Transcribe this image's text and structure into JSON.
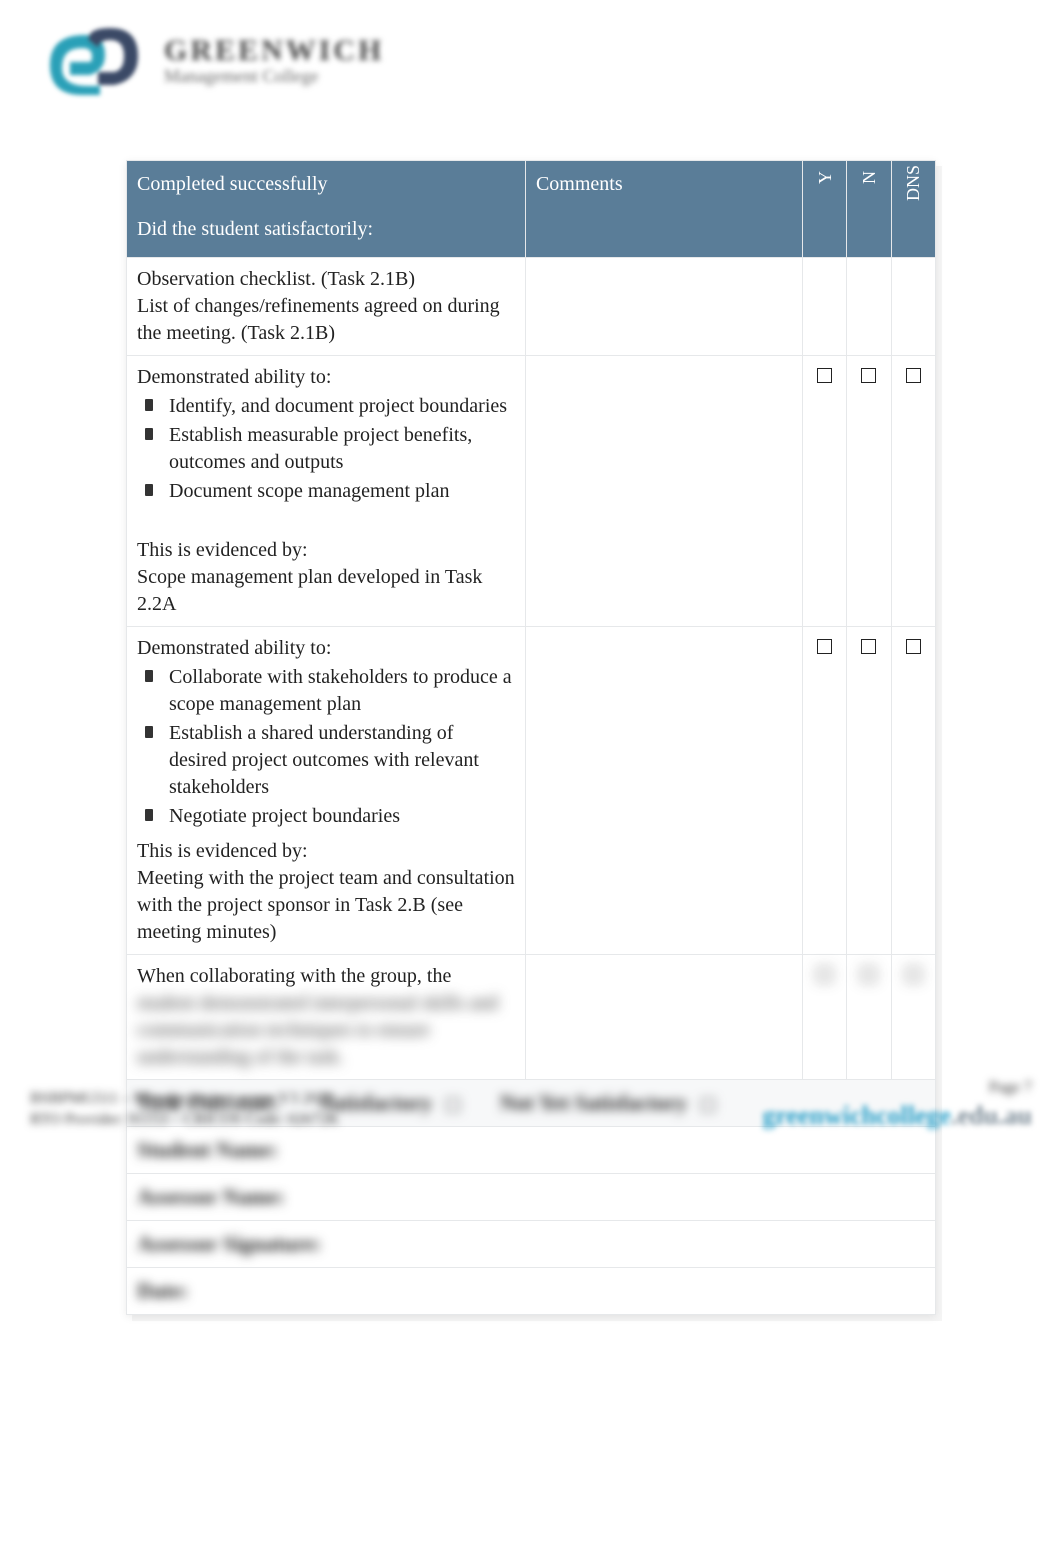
{
  "logo": {
    "line1": "GREENWICH",
    "line2": "Management College"
  },
  "header": {
    "col1_line1": "Completed successfully",
    "col1_line2": "Did the student satisfactorily:",
    "col2": "Comments",
    "col3": "Y",
    "col4": "N",
    "col5": "DNS"
  },
  "rows": [
    {
      "type": "plain",
      "lines": [
        "Observation checklist. (Task 2.1B)",
        "List of changes/refinements agreed on during the meeting. (Task 2.1B)"
      ],
      "checks": false
    },
    {
      "type": "ability",
      "intro": "Demonstrated ability to:",
      "bullets": [
        "Identify, and document project boundaries",
        "Establish measurable project benefits, outcomes and outputs",
        "Document scope management plan"
      ],
      "evidence_label": "This is evidenced by:",
      "evidence": "Scope management plan developed in Task 2.2A",
      "checks": true
    },
    {
      "type": "ability",
      "intro": "Demonstrated ability to:",
      "bullets": [
        "Collaborate with stakeholders to produce a scope management plan",
        "Establish a shared understanding of desired project outcomes with relevant stakeholders",
        "Negotiate project boundaries"
      ],
      "evidence_label": "This is evidenced by:",
      "evidence": "Meeting with the project team and consultation with the project sponsor in Task 2.B (see meeting minutes)",
      "checks": true
    },
    {
      "type": "collab",
      "line": "When collaborating with the group, the",
      "blur": "student demonstrated interpersonal skills and communication techniques to ensure understanding of the task.",
      "checks": true,
      "checks_blur": true
    }
  ],
  "outcome": {
    "label": "Task Outcome:",
    "sat": "Satisfactory",
    "nys": "Not Yet Satisfactory"
  },
  "signoff": {
    "student": "Student Name:",
    "assessor": "Assessor Name:",
    "signature": "Assessor Signature:",
    "date": "Date:"
  },
  "footer": {
    "left_l1": "BSBPMG511 – Manage project scope V3 2020",
    "left_l2": "RTO Provider: 91153 – CRICOS Code: 02672K",
    "page": "Page 7",
    "url_a": "greenwichcollege",
    "url_b": ".edu.au"
  }
}
